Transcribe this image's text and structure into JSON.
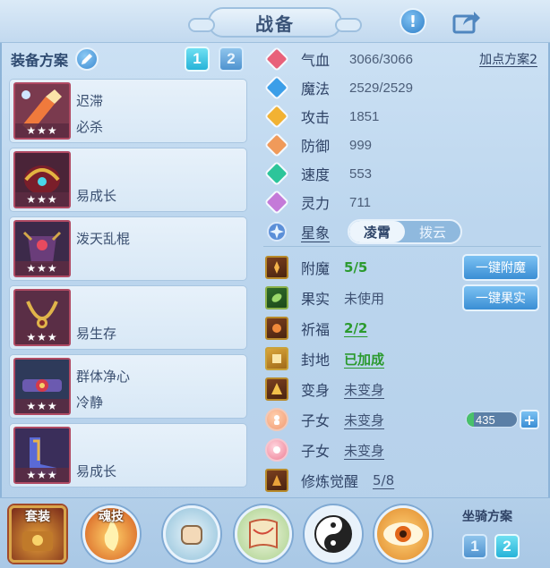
{
  "header": {
    "title": "战备"
  },
  "equip_panel": {
    "label": "装备方案",
    "tabs": [
      "1",
      "2"
    ],
    "active_tab": "1",
    "items": [
      {
        "line1": "迟滞",
        "line2": "必杀",
        "stars": "★★★"
      },
      {
        "line1": "",
        "line2": "易成长",
        "stars": "★★★"
      },
      {
        "line1": "泼天乱棍",
        "line2": "",
        "stars": "★★★"
      },
      {
        "line1": "",
        "line2": "易生存",
        "stars": "★★★"
      },
      {
        "line1": "群体净心",
        "line2": "冷静",
        "stars": "★★★"
      },
      {
        "line1": "",
        "line2": "易成长",
        "stars": "★★★"
      }
    ]
  },
  "stats": {
    "plan_link": "加点方案2",
    "rows": [
      {
        "label": "气血",
        "value": "3066/3066",
        "color": "#e8617a"
      },
      {
        "label": "魔法",
        "value": "2529/2529",
        "color": "#3b9ee8"
      },
      {
        "label": "攻击",
        "value": "1851",
        "color": "#f2b233"
      },
      {
        "label": "防御",
        "value": "999",
        "color": "#f09a5a"
      },
      {
        "label": "速度",
        "value": "553",
        "color": "#2cc59a"
      },
      {
        "label": "灵力",
        "value": "711",
        "color": "#c47ad8"
      }
    ],
    "xingxiang": {
      "label": "星象",
      "options": [
        "凌霄",
        "拨云"
      ],
      "selected": "凌霄"
    }
  },
  "features": [
    {
      "label": "附魔",
      "value": "5/5",
      "button": "一键附魔"
    },
    {
      "label": "果实",
      "value": "未使用",
      "button": "一键果实"
    },
    {
      "label": "祈福",
      "value": "2/2"
    },
    {
      "label": "封地",
      "value": "已加成"
    },
    {
      "label": "变身",
      "value": "未变身"
    },
    {
      "label": "子女",
      "value": "未变身",
      "bar_value": "435",
      "bar_fraction": 0.15
    },
    {
      "label": "子女",
      "value": "未变身"
    },
    {
      "label": "修炼觉醒",
      "value": "5/8"
    }
  ],
  "bottom": {
    "skills": [
      {
        "tag": "套装"
      },
      {
        "tag": "魂技"
      },
      {
        "tag": ""
      },
      {
        "tag": ""
      },
      {
        "tag": ""
      },
      {
        "tag": ""
      }
    ],
    "mount_label": "坐骑方案",
    "mount_tabs": [
      "1",
      "2"
    ],
    "mount_active": "2"
  }
}
